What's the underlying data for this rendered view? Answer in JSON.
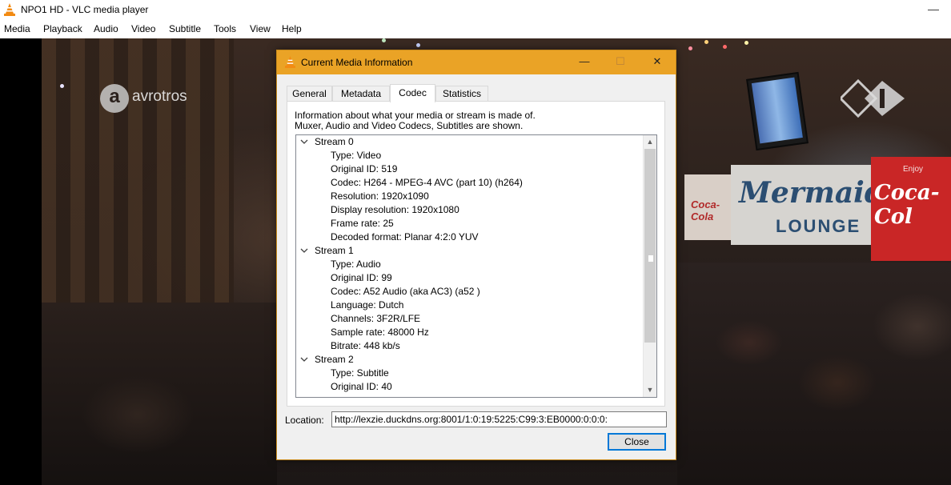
{
  "app": {
    "title": "NPO1 HD - VLC media player",
    "minimize_glyph": "—",
    "icon": "vlc-cone-icon"
  },
  "menu": [
    "Media",
    "Playback",
    "Audio",
    "Video",
    "Subtitle",
    "Tools",
    "View",
    "Help"
  ],
  "video": {
    "channel_logo_glyph": "a",
    "channel_logo_text": "avrotros",
    "signs": {
      "coke_left": "Coca-Cola",
      "mermaid_line1": "Mermaid",
      "mermaid_line2": "LOUNGE",
      "coke_right_enjoy": "Enjoy",
      "coke_right": "Coca-Col"
    },
    "npo_badge_icon": "npo1-logo-icon"
  },
  "dialog": {
    "title": "Current Media Information",
    "controls": {
      "minimize": "—",
      "maximize": "☐",
      "close": "✕"
    },
    "accent_color": "#eaa326",
    "tabs": [
      {
        "label": "General",
        "active": false
      },
      {
        "label": "Metadata",
        "active": false
      },
      {
        "label": "Codec",
        "active": true
      },
      {
        "label": "Statistics",
        "active": false
      }
    ],
    "info_line1": "Information about what your media or stream is made of.",
    "info_line2": "Muxer, Audio and Video Codecs, Subtitles are shown.",
    "streams": [
      {
        "label": "Stream 0",
        "fields": [
          "Type: Video",
          "Original ID: 519",
          "Codec: H264 - MPEG-4 AVC (part 10) (h264)",
          "Resolution: 1920x1090",
          "Display resolution: 1920x1080",
          "Frame rate: 25",
          "Decoded format: Planar 4:2:0 YUV"
        ]
      },
      {
        "label": "Stream 1",
        "fields": [
          "Type: Audio",
          "Original ID: 99",
          "Codec: A52 Audio (aka AC3) (a52 )",
          "Language: Dutch",
          "Channels: 3F2R/LFE",
          "Sample rate: 48000 Hz",
          "Bitrate: 448 kb/s"
        ]
      },
      {
        "label": "Stream 2",
        "fields": [
          "Type: Subtitle",
          "Original ID: 40"
        ]
      }
    ],
    "location_label": "Location:",
    "location_value": "http://lexzie.duckdns.org:8001/1:0:19:5225:C99:3:EB0000:0:0:0:",
    "close_label": "Close",
    "scroll_up": "▲",
    "scroll_down": "▼"
  }
}
